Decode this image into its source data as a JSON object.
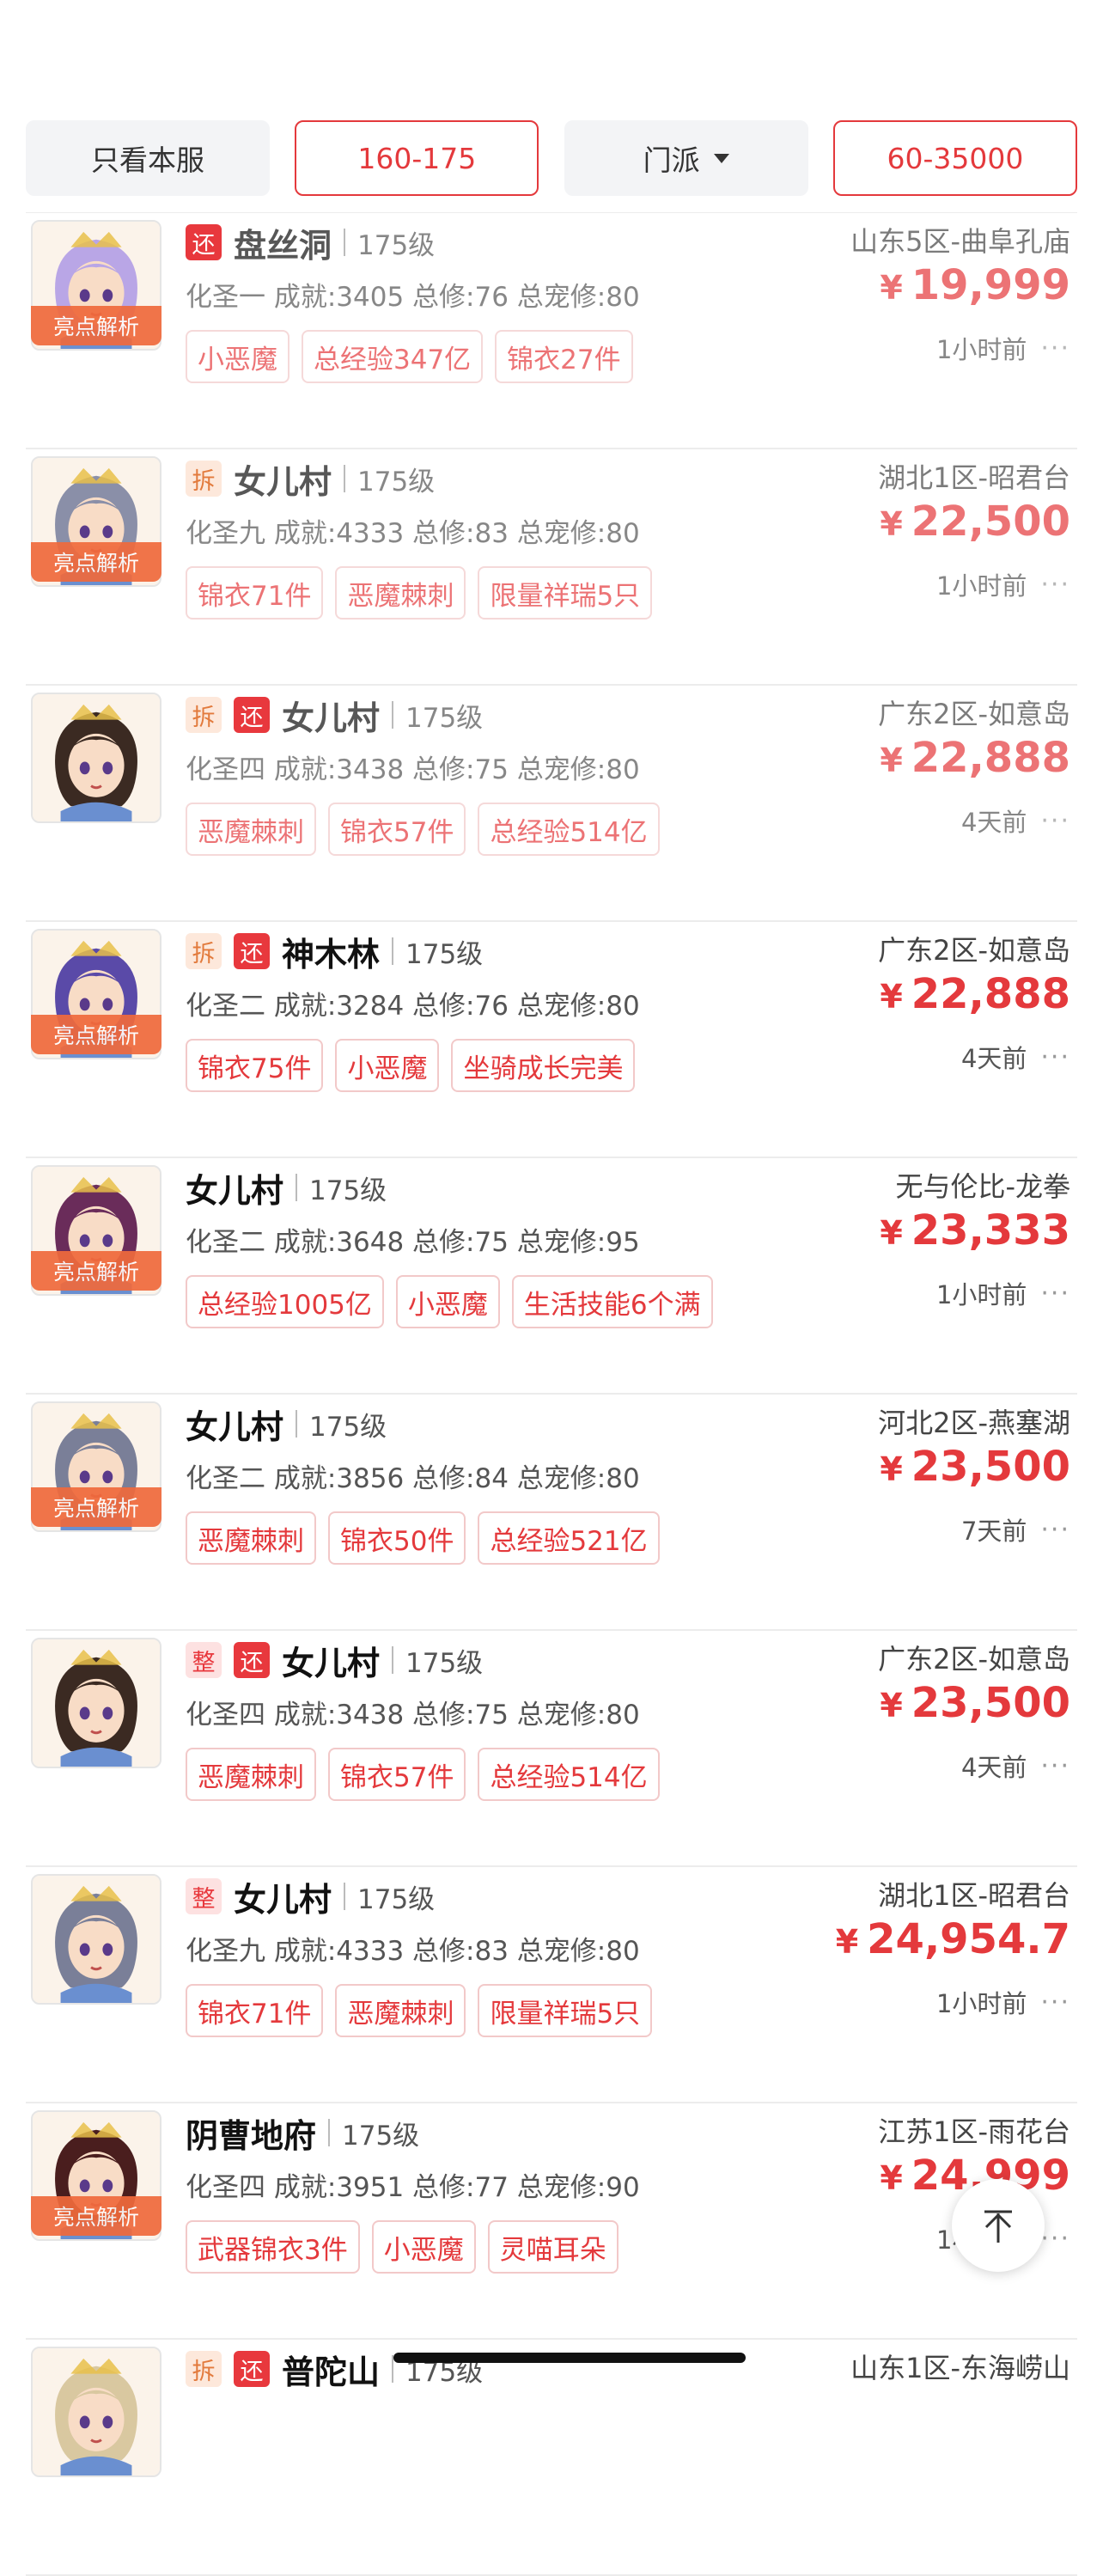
{
  "filters": [
    {
      "label": "只看本服",
      "style": "plain"
    },
    {
      "label": "160-175",
      "style": "active"
    },
    {
      "label": "门派",
      "style": "plain",
      "dropdown": true
    },
    {
      "label": "60-35000",
      "style": "active"
    }
  ],
  "highlight_label": "亮点解析",
  "items": [
    {
      "badges": [
        "还"
      ],
      "sect": "盘丝洞",
      "level": "175级",
      "stats": "化圣一 成就:3405 总修:76 总宠修:80",
      "tags": [
        "小恶魔",
        "总经验347亿",
        "锦衣27件"
      ],
      "server": "山东5区-曲阜孔庙",
      "price": "19,999",
      "time": "1小时前",
      "highlight": true,
      "dim": true,
      "hair": "#b9a6e6"
    },
    {
      "badges": [
        "拆"
      ],
      "sect": "女儿村",
      "level": "175级",
      "stats": "化圣九 成就:4333 总修:83 总宠修:80",
      "tags": [
        "锦衣71件",
        "恶魔棘刺",
        "限量祥瑞5只"
      ],
      "server": "湖北1区-昭君台",
      "price": "22,500",
      "time": "1小时前",
      "highlight": true,
      "dim": true,
      "hair": "#8a8fa8"
    },
    {
      "badges": [
        "拆",
        "还"
      ],
      "sect": "女儿村",
      "level": "175级",
      "stats": "化圣四 成就:3438 总修:75 总宠修:80",
      "tags": [
        "恶魔棘刺",
        "锦衣57件",
        "总经验514亿"
      ],
      "server": "广东2区-如意岛",
      "price": "22,888",
      "time": "4天前",
      "highlight": false,
      "dim": true,
      "hair": "#3b2a22"
    },
    {
      "badges": [
        "拆",
        "还"
      ],
      "sect": "神木林",
      "level": "175级",
      "stats": "化圣二 成就:3284 总修:76 总宠修:80",
      "tags": [
        "锦衣75件",
        "小恶魔",
        "坐骑成长完美"
      ],
      "server": "广东2区-如意岛",
      "price": "22,888",
      "time": "4天前",
      "highlight": true,
      "dim": false,
      "hair": "#5a4aa8"
    },
    {
      "badges": [],
      "sect": "女儿村",
      "level": "175级",
      "stats": "化圣二 成就:3648 总修:75 总宠修:95",
      "tags": [
        "总经验1005亿",
        "小恶魔",
        "生活技能6个满"
      ],
      "server": "无与伦比-龙拳",
      "price": "23,333",
      "time": "1小时前",
      "highlight": true,
      "dim": false,
      "hair": "#6a2c5a"
    },
    {
      "badges": [],
      "sect": "女儿村",
      "level": "175级",
      "stats": "化圣二 成就:3856 总修:84 总宠修:80",
      "tags": [
        "恶魔棘刺",
        "锦衣50件",
        "总经验521亿"
      ],
      "server": "河北2区-燕塞湖",
      "price": "23,500",
      "time": "7天前",
      "highlight": true,
      "dim": false,
      "hair": "#7a7f98"
    },
    {
      "badges": [
        "整",
        "还"
      ],
      "sect": "女儿村",
      "level": "175级",
      "stats": "化圣四 成就:3438 总修:75 总宠修:80",
      "tags": [
        "恶魔棘刺",
        "锦衣57件",
        "总经验514亿"
      ],
      "server": "广东2区-如意岛",
      "price": "23,500",
      "time": "4天前",
      "highlight": false,
      "dim": false,
      "hair": "#3b2a22"
    },
    {
      "badges": [
        "整"
      ],
      "sect": "女儿村",
      "level": "175级",
      "stats": "化圣九 成就:4333 总修:83 总宠修:80",
      "tags": [
        "锦衣71件",
        "恶魔棘刺",
        "限量祥瑞5只"
      ],
      "server": "湖北1区-昭君台",
      "price": "24,954.7",
      "time": "1小时前",
      "highlight": false,
      "dim": false,
      "hair": "#7a7f98"
    },
    {
      "badges": [],
      "sect": "阴曹地府",
      "level": "175级",
      "stats": "化圣四 成就:3951 总修:77 总宠修:90",
      "tags": [
        "武器锦衣3件",
        "小恶魔",
        "灵喵耳朵"
      ],
      "server": "江苏1区-雨花台",
      "price": "24,999",
      "time": "1小时前",
      "highlight": true,
      "dim": false,
      "hair": "#4a1e1e"
    },
    {
      "badges": [
        "拆",
        "还"
      ],
      "sect": "普陀山",
      "level": "175级",
      "stats": "",
      "tags": [],
      "server": "山东1区-东海崂山",
      "price": "",
      "time": "",
      "highlight": false,
      "dim": false,
      "hair": "#d9c8a0"
    }
  ],
  "currency": "¥"
}
